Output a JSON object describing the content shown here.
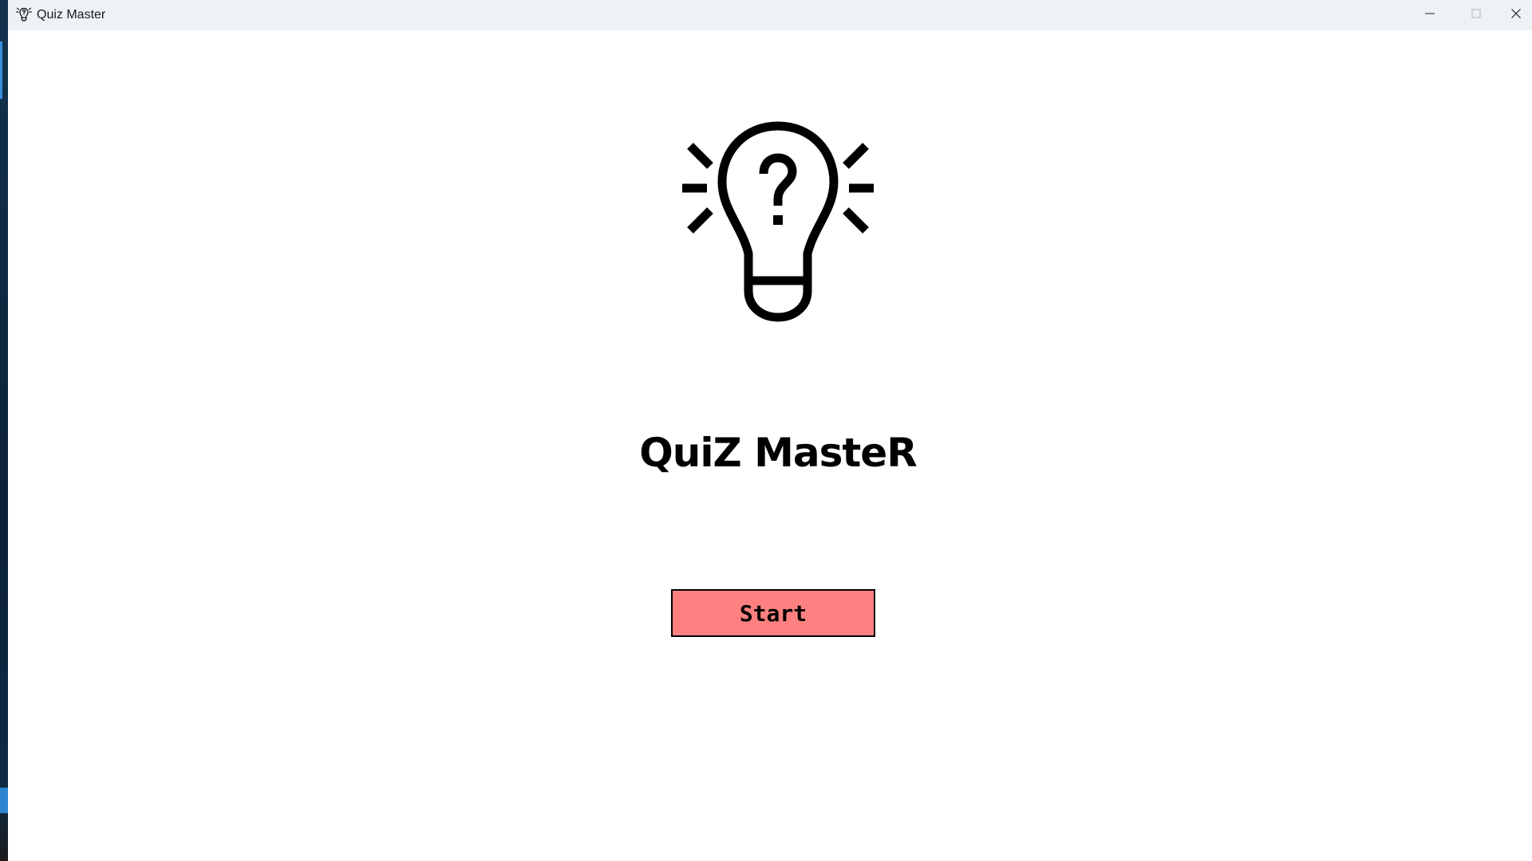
{
  "window": {
    "title": "Quiz Master",
    "app_icon": "lightbulb-question-icon",
    "controls": {
      "minimize_icon": "minimize-icon",
      "maximize_icon": "maximize-icon",
      "close_icon": "close-icon"
    }
  },
  "main": {
    "logo_icon": "lightbulb-question-icon",
    "title": "QuiZ MasteR",
    "start_button_label": "Start"
  },
  "colors": {
    "titlebar_bg": "#eef1f5",
    "content_bg": "#ffffff",
    "start_button_bg": "#ff8080",
    "text": "#000000"
  }
}
